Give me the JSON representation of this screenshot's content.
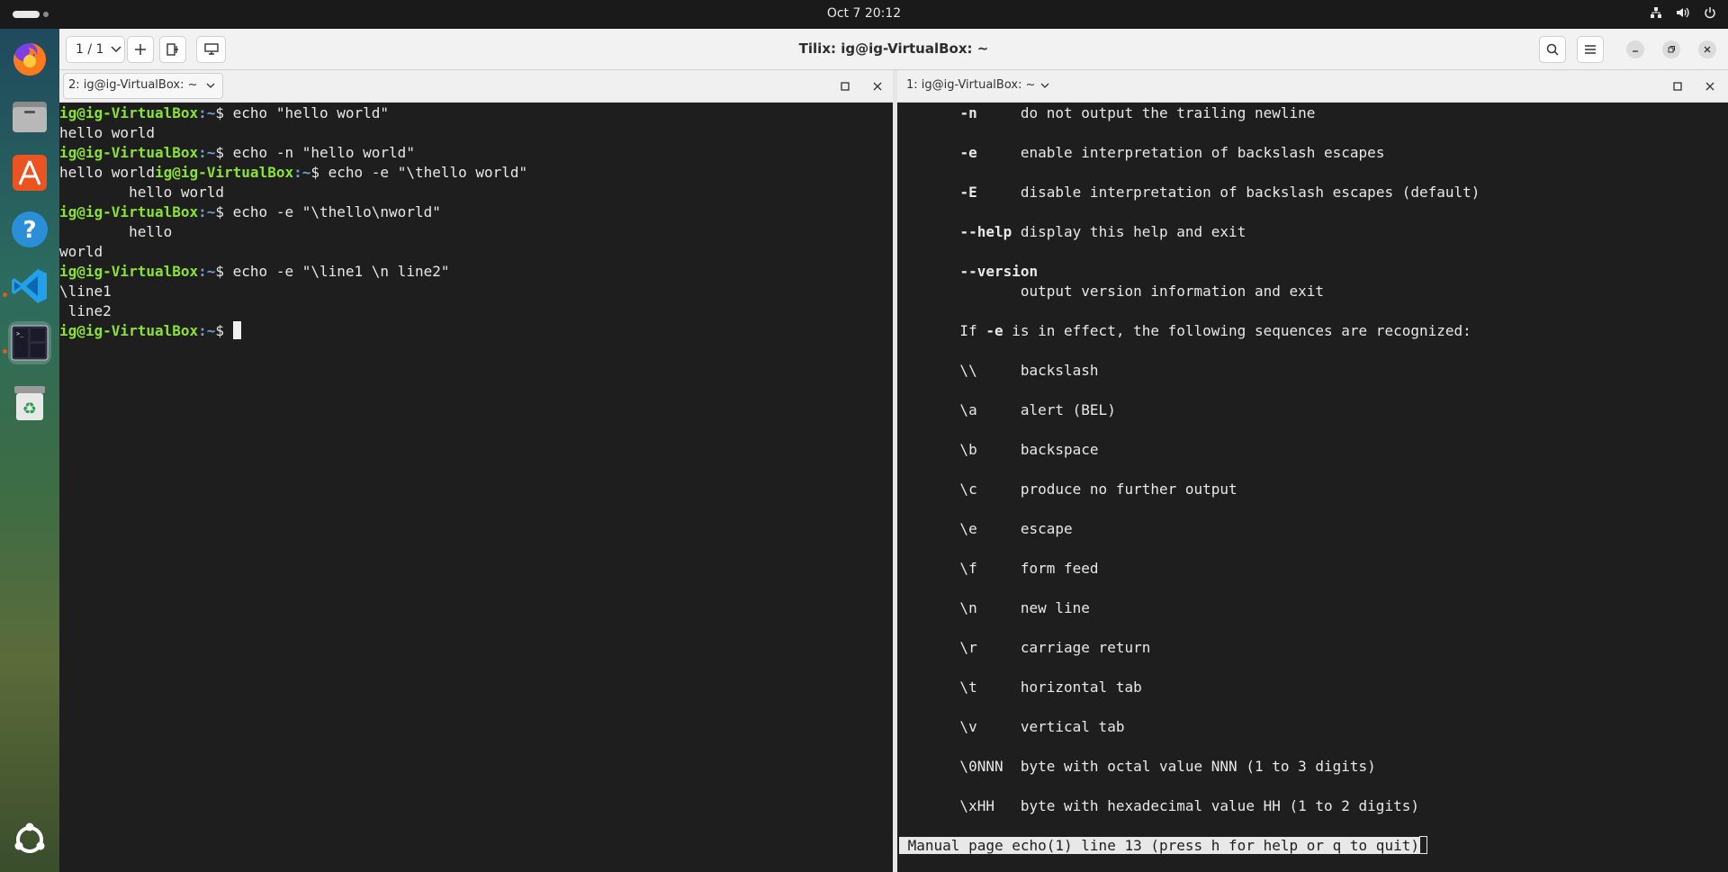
{
  "topbar": {
    "clock": "Oct 7  20:12"
  },
  "dock": {
    "items": [
      {
        "name": "firefox-icon"
      },
      {
        "name": "files-icon"
      },
      {
        "name": "app-center-icon"
      },
      {
        "name": "help-icon"
      },
      {
        "name": "vscode-icon"
      },
      {
        "name": "tilix-icon"
      },
      {
        "name": "trash-icon"
      },
      {
        "name": "show-apps-icon"
      }
    ]
  },
  "window": {
    "title": "Tilix: ig@ig-VirtualBox: ~",
    "session_label": "1 / 1"
  },
  "left_pane": {
    "tab_label": "2: ig@ig-VirtualBox: ~",
    "lines": [
      {
        "user": "ig@ig-VirtualBox",
        "path": ":~",
        "cmd": "$ echo \"hello world\""
      },
      {
        "text": "hello world"
      },
      {
        "user": "ig@ig-VirtualBox",
        "path": ":~",
        "cmd": "$ echo -n \"hello world\""
      },
      {
        "pre": "hello world",
        "user": "ig@ig-VirtualBox",
        "path": ":~",
        "cmd": "$ echo -e \"\\thello world\""
      },
      {
        "text": "        hello world"
      },
      {
        "user": "ig@ig-VirtualBox",
        "path": ":~",
        "cmd": "$ echo -e \"\\thello\\nworld\""
      },
      {
        "text": "        hello"
      },
      {
        "text": "world"
      },
      {
        "user": "ig@ig-VirtualBox",
        "path": ":~",
        "cmd": "$ echo -e \"\\line1 \\n line2\""
      },
      {
        "text": "\\line1"
      },
      {
        "text": " line2"
      },
      {
        "user": "ig@ig-VirtualBox",
        "path": ":~",
        "cmd": "$ ",
        "cursor": true
      }
    ]
  },
  "right_pane": {
    "tab_label": "1: ig@ig-VirtualBox: ~",
    "lines": [
      {
        "opt": "-n",
        "desc": "     do not output the trailing newline"
      },
      {
        "text": ""
      },
      {
        "opt": "-e",
        "desc": "     enable interpretation of backslash escapes"
      },
      {
        "text": ""
      },
      {
        "opt": "-E",
        "desc": "     disable interpretation of backslash escapes (default)"
      },
      {
        "text": ""
      },
      {
        "opt": "--help",
        "desc": " display this help and exit"
      },
      {
        "text": ""
      },
      {
        "opt": "--version",
        "desc": ""
      },
      {
        "text": "              output version information and exit"
      },
      {
        "text": ""
      },
      {
        "text": "       If ",
        "opt_inline": "-e",
        "rest": " is in effect, the following sequences are recognized:"
      },
      {
        "text": ""
      },
      {
        "text": "       \\\\     backslash"
      },
      {
        "text": ""
      },
      {
        "text": "       \\a     alert (BEL)"
      },
      {
        "text": ""
      },
      {
        "text": "       \\b     backspace"
      },
      {
        "text": ""
      },
      {
        "text": "       \\c     produce no further output"
      },
      {
        "text": ""
      },
      {
        "text": "       \\e     escape"
      },
      {
        "text": ""
      },
      {
        "text": "       \\f     form feed"
      },
      {
        "text": ""
      },
      {
        "text": "       \\n     new line"
      },
      {
        "text": ""
      },
      {
        "text": "       \\r     carriage return"
      },
      {
        "text": ""
      },
      {
        "text": "       \\t     horizontal tab"
      },
      {
        "text": ""
      },
      {
        "text": "       \\v     vertical tab"
      },
      {
        "text": ""
      },
      {
        "text": "       \\0NNN  byte with octal value NNN (1 to 3 digits)"
      },
      {
        "text": ""
      },
      {
        "text": "       \\xHH   byte with hexadecimal value HH (1 to 2 digits)"
      },
      {
        "text": ""
      }
    ],
    "status": " Manual page echo(1) line 13 (press h for help or q to quit)"
  }
}
